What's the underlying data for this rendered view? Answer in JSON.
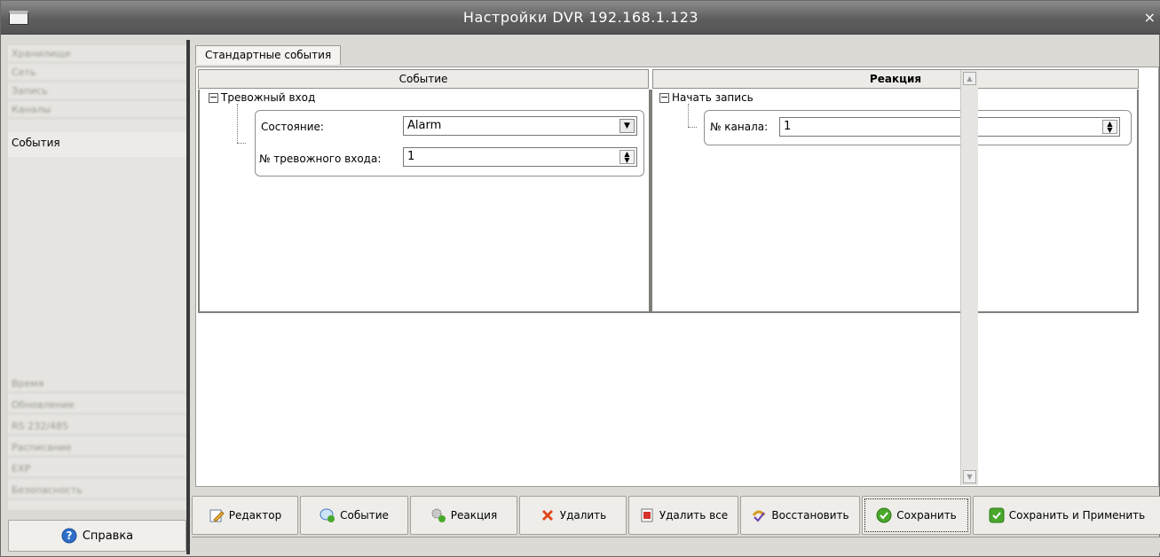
{
  "window": {
    "title": "Настройки DVR 192.168.1.123",
    "close_glyph": "×"
  },
  "sidebar": {
    "items_top": [
      {
        "label": "Хранилище"
      },
      {
        "label": "Сеть"
      },
      {
        "label": "Запись"
      },
      {
        "label": "Каналы"
      }
    ],
    "active_item": {
      "label": "События"
    },
    "items_bottom": [
      {
        "label": "Время"
      },
      {
        "label": "Обновление"
      },
      {
        "label": "RS 232/485"
      },
      {
        "label": "Расписание"
      },
      {
        "label": "EXP"
      },
      {
        "label": "Безопасность"
      }
    ],
    "help_label": "Справка"
  },
  "tab": {
    "label": "Стандартные события"
  },
  "table": {
    "event_header": "Событие",
    "reaction_header": "Реакция",
    "event": {
      "node_label": "Тревожный вход",
      "state_label": "Состояние:",
      "state_value": "Alarm",
      "input_label": "№ тревожного входа:",
      "input_value": "1"
    },
    "reaction": {
      "node_label": "Начать запись",
      "channel_label": "№ канала:",
      "channel_value": "1"
    }
  },
  "toolbar": {
    "buttons": [
      {
        "label": "Редактор",
        "icon": "edit-icon"
      },
      {
        "label": "Событие",
        "icon": "event-icon"
      },
      {
        "label": "Реакция",
        "icon": "reaction-icon"
      },
      {
        "label": "Удалить",
        "icon": "delete-icon"
      },
      {
        "label": "Удалить все",
        "icon": "delete-all-icon"
      },
      {
        "label": "Восстановить",
        "icon": "restore-icon"
      },
      {
        "label": "Сохранить",
        "icon": "save-icon"
      },
      {
        "label": "Сохранить и Применить",
        "icon": "save-apply-icon"
      }
    ]
  },
  "colors": {
    "titlebar": "#5e5e5e",
    "help_icon": "#2f6fc8",
    "delete_icon": "#e0461b",
    "save_icon": "#49a82b"
  }
}
